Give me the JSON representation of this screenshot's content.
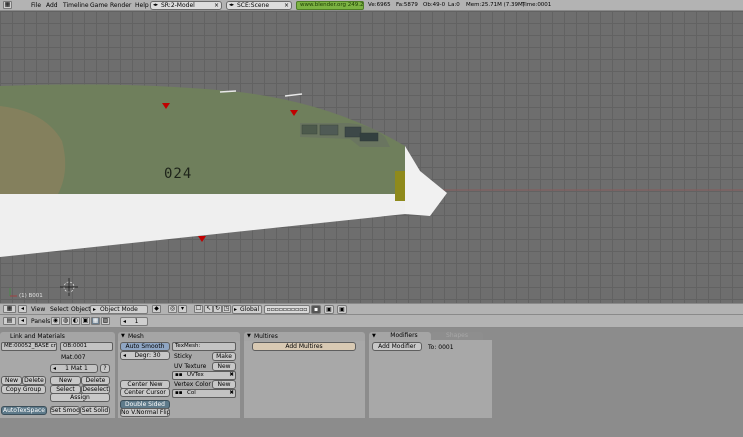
{
  "topbar": {
    "menus": [
      "File",
      "Add",
      "Timeline",
      "Game",
      "Render",
      "Help"
    ],
    "screen_field": "SR:2-Model",
    "scene_field": "SCE:Scene",
    "url": "www.blender.org 249.2",
    "stats": {
      "verts": "Ve:6965",
      "faces": "Fa:5879",
      "objects": "Ob:49-0",
      "lamps": "La:0",
      "memory": "Mem:25.71M (7.39M)",
      "time": "Time:0001"
    }
  },
  "viewport": {
    "object_label": "(1) B001",
    "hull_number": "024"
  },
  "vp_header": {
    "view": "View",
    "select": "Select",
    "object": "Object",
    "mode": "Object Mode",
    "orientation": "Global"
  },
  "btn_header": {
    "panels": "Panels",
    "frame": "1"
  },
  "link_materials": {
    "title": "Link and Materials",
    "me_field": "ME:00052_BASE crf.",
    "ob_field": "OB:0001",
    "mat_name": "Mat.007",
    "mat_slot": "1 Mat 1",
    "mat_q": "?",
    "new_1": "New",
    "delete_1": "Delete",
    "copy_group": "Copy Group",
    "new_2": "New",
    "delete_2": "Delete",
    "select": "Select",
    "deselect": "Deselect",
    "assign": "Assign",
    "autotexspace": "AutoTexSpace",
    "set_smooth": "Set Smooth",
    "set_solid": "Set Solid"
  },
  "mesh": {
    "title": "Mesh",
    "auto_smooth": "Auto Smooth",
    "degr": "Degr: 30",
    "center_new": "Center New",
    "center_cursor": "Center Cursor",
    "double_sided": "Double Sided",
    "no_v_normal_flip": "No V.Normal Flip",
    "texmesh": "TexMesh:",
    "sticky": "Sticky",
    "make": "Make",
    "uv_texture": "UV Texture",
    "new_uv": "New",
    "uvtex": "UVTex",
    "vertex_color": "Vertex Color",
    "new_vc": "New",
    "col": "Col"
  },
  "multires": {
    "title": "Multires",
    "add": "Add Multires"
  },
  "modifiers": {
    "tab_modifiers": "Modifiers",
    "tab_shapes": "Shapes",
    "add": "Add Modifier",
    "to": "To: 0001"
  }
}
